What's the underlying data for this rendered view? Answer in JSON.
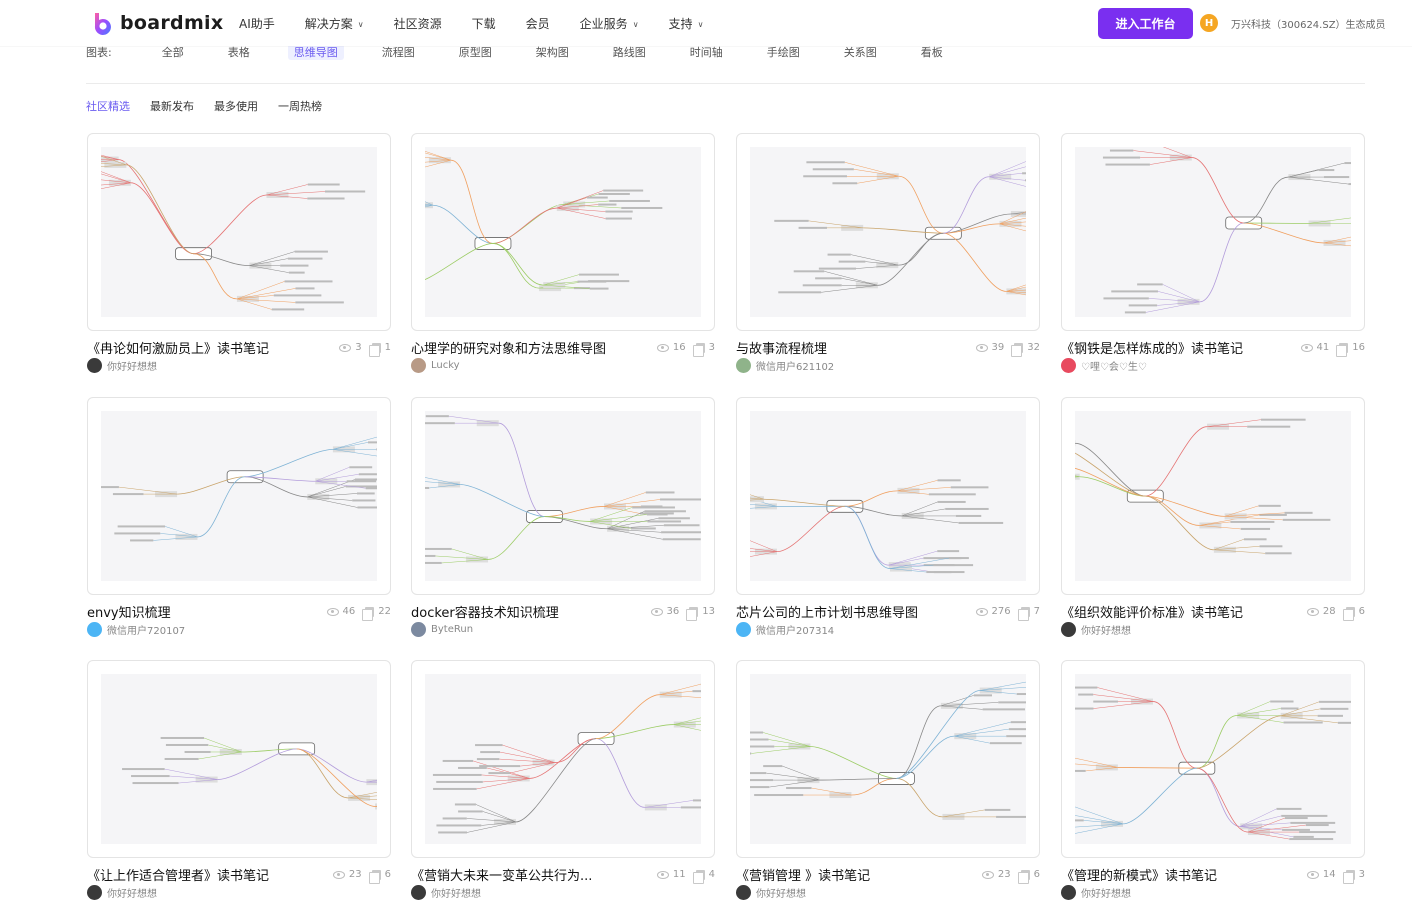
{
  "header": {
    "logo_text": "boardmix",
    "nav": [
      {
        "label": "AI助手",
        "dropdown": false
      },
      {
        "label": "解决方案",
        "dropdown": true
      },
      {
        "label": "社区资源",
        "dropdown": false
      },
      {
        "label": "下载",
        "dropdown": false
      },
      {
        "label": "会员",
        "dropdown": false
      },
      {
        "label": "企业服务",
        "dropdown": true
      },
      {
        "label": "支持",
        "dropdown": true
      }
    ],
    "cta_label": "进入工作台",
    "badge_letter": "H",
    "eco_text": "万兴科技（300624.SZ）生态成员",
    "brand_color": "#7a2ff0"
  },
  "categories": {
    "label": "图表:",
    "items": [
      "全部",
      "表格",
      "思维导图",
      "流程图",
      "原型图",
      "架构图",
      "路线图",
      "时间轴",
      "手绘图",
      "关系图",
      "看板"
    ],
    "active": "思维导图"
  },
  "tabs": {
    "items": [
      "社区精选",
      "最新发布",
      "最多使用",
      "一周热榜"
    ],
    "active": "社区精选",
    "accent": "#6b5cf0"
  },
  "cards": [
    {
      "title": "《冉论如何激励员上》读书笔记",
      "views": "3",
      "copies": "1",
      "author": "你好好想想",
      "avatar": "dark"
    },
    {
      "title": "心埋学的研究对象和方法思维导图",
      "views": "16",
      "copies": "3",
      "author": "Lucky",
      "avatar": "photo"
    },
    {
      "title": "与故事流程梳埋",
      "views": "39",
      "copies": "32",
      "author": "微信用户621102",
      "avatar": "green"
    },
    {
      "title": "《钢铁是怎样炼成的》读书笔记",
      "views": "41",
      "copies": "16",
      "author": "♡哩♡会♡生♡",
      "avatar": "red"
    },
    {
      "title": "envy知识梳理",
      "views": "46",
      "copies": "22",
      "author": "微信用户720107",
      "avatar": "wechat"
    },
    {
      "title": "docker容器技术知识梳理",
      "views": "36",
      "copies": "13",
      "author": "ByteRun",
      "avatar": "gray"
    },
    {
      "title": "芯片公司的上市计划书思维导图",
      "views": "276",
      "copies": "7",
      "author": "微信用户207314",
      "avatar": "wechat"
    },
    {
      "title": "《组织效能评价标准》读书笔记",
      "views": "28",
      "copies": "6",
      "author": "你好好想想",
      "avatar": "dark"
    },
    {
      "title": "《让上作适合管埋者》读书笔记",
      "views": "23",
      "copies": "6",
      "author": "你好好想想",
      "avatar": "dark"
    },
    {
      "title": "《营销大未来一变革公共行为...",
      "views": "11",
      "copies": "4",
      "author": "你好好想想",
      "avatar": "dark"
    },
    {
      "title": "《营销管埋 》读书笔记",
      "views": "23",
      "copies": "6",
      "author": "你好好想想",
      "avatar": "dark"
    },
    {
      "title": "《管理的新模式》读书笔记",
      "views": "14",
      "copies": "3",
      "author": "你好好想想",
      "avatar": "dark"
    }
  ]
}
